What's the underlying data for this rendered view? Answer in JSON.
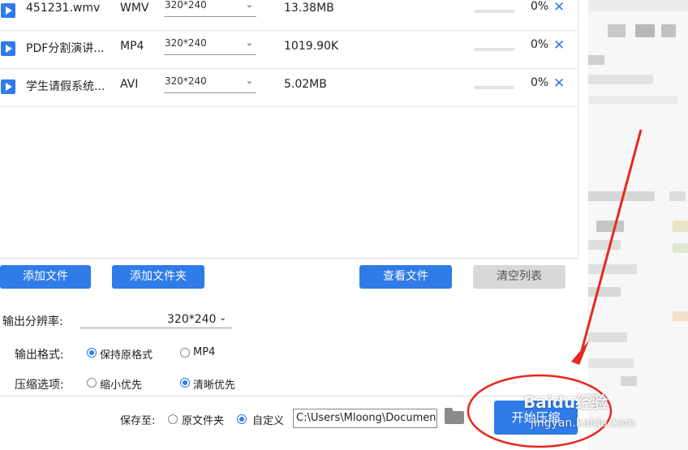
{
  "files": [
    {
      "name": "451231.wmv",
      "format": "WMV",
      "resolution": "320*240",
      "size": "13.38MB",
      "progress": 0,
      "percent_label": "0%"
    },
    {
      "name": "PDF分割演讲...",
      "format": "MP4",
      "resolution": "320*240",
      "size": "1019.90KB",
      "progress": 0,
      "percent_label": "0%"
    },
    {
      "name": "学生请假系统...",
      "format": "AVI",
      "resolution": "320*240",
      "size": "5.02MB",
      "progress": 0,
      "percent_label": "0%"
    }
  ],
  "toolbar": {
    "add_file": "添加文件",
    "add_folder": "添加文件夹",
    "view_files": "查看文件",
    "clear_list": "清空列表"
  },
  "settings": {
    "resolution_label": "输出分辨率:",
    "resolution_value": "320*240",
    "format_label": "输出格式:",
    "format_options": [
      "保持原格式",
      "MP4"
    ],
    "format_selected": 0,
    "compress_label": "压缩选项:",
    "compress_options": [
      "缩小优先",
      "清晰优先"
    ],
    "compress_selected": 1
  },
  "save": {
    "label": "保存至:",
    "options": [
      "原文件夹",
      "自定义"
    ],
    "selected": 1,
    "path": "C:\\Users\\Mloong\\Documents"
  },
  "start_button": "开始压缩",
  "watermark": {
    "line1": "Baidu经验",
    "line2": "jingyan.baidu.com"
  },
  "colors": {
    "accent": "#2f7be8",
    "annotation": "#e8281e"
  }
}
